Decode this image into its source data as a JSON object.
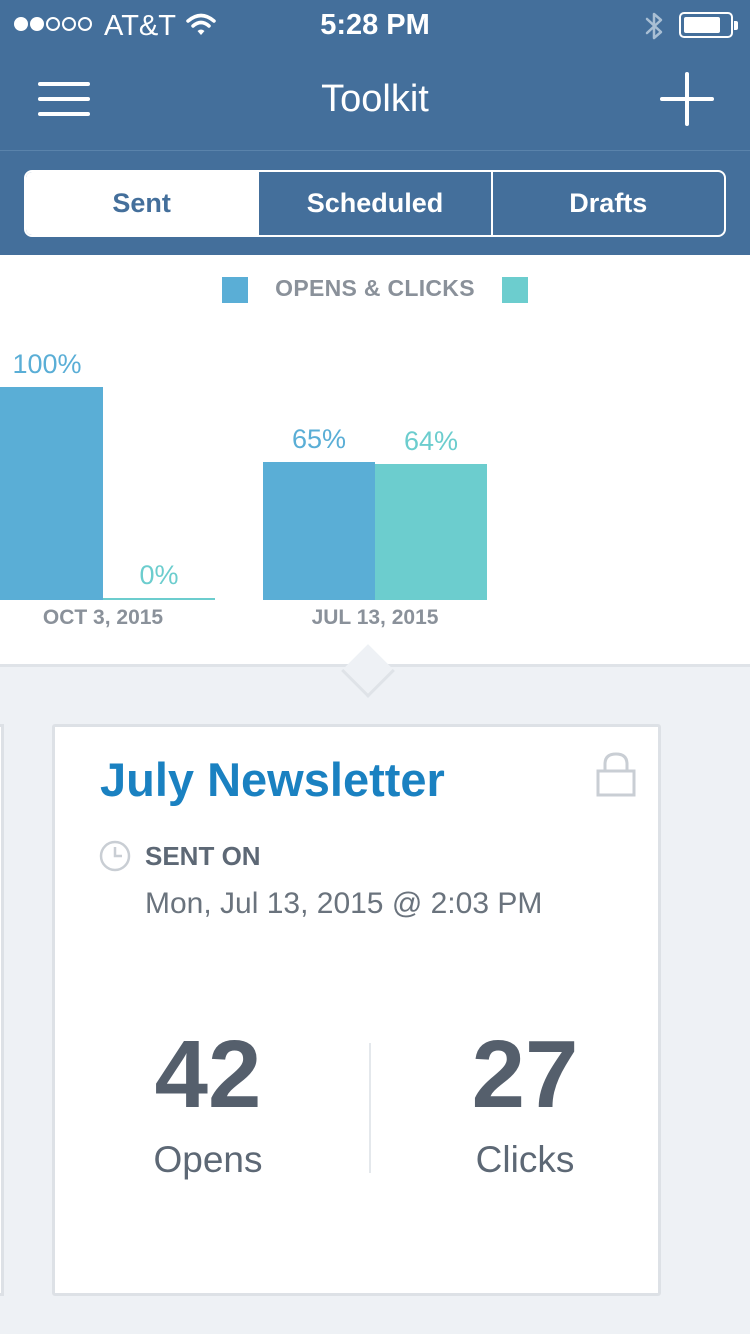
{
  "status_bar": {
    "carrier": "AT&T",
    "time": "5:28 PM",
    "signal_bars_filled": 2,
    "signal_bars_total": 5
  },
  "nav": {
    "title": "Toolkit",
    "menu_icon": "hamburger-menu-icon",
    "add_icon": "plus-icon"
  },
  "tabs": [
    {
      "label": "Sent",
      "active": true
    },
    {
      "label": "Scheduled",
      "active": false
    },
    {
      "label": "Drafts",
      "active": false
    }
  ],
  "colors": {
    "header": "#446f9b",
    "opens": "#5aaed6",
    "clicks": "#6ccdce",
    "title_blue": "#1a81c1"
  },
  "chart_data": {
    "type": "bar",
    "title": "OPENS & CLICKS",
    "categories": [
      "OCT 3, 2015",
      "JUL 13, 2015"
    ],
    "series": [
      {
        "values": [
          100,
          65
        ],
        "labels": [
          "100%",
          "65%"
        ],
        "color": "#5aaed6"
      },
      {
        "values": [
          0,
          64
        ],
        "labels": [
          "0%",
          "64%"
        ],
        "color": "#6ccdce"
      }
    ],
    "ylim": [
      0,
      100
    ],
    "grid": false
  },
  "card": {
    "title": "July Newsletter",
    "sent_on_label": "SENT ON",
    "sent_date": "Mon, Jul 13, 2015 @ 2:03 PM",
    "opens_value": "42",
    "opens_label": "Opens",
    "clicks_value": "27",
    "clicks_label": "Clicks",
    "lock_icon": "lock-icon",
    "clock_icon": "clock-icon"
  }
}
